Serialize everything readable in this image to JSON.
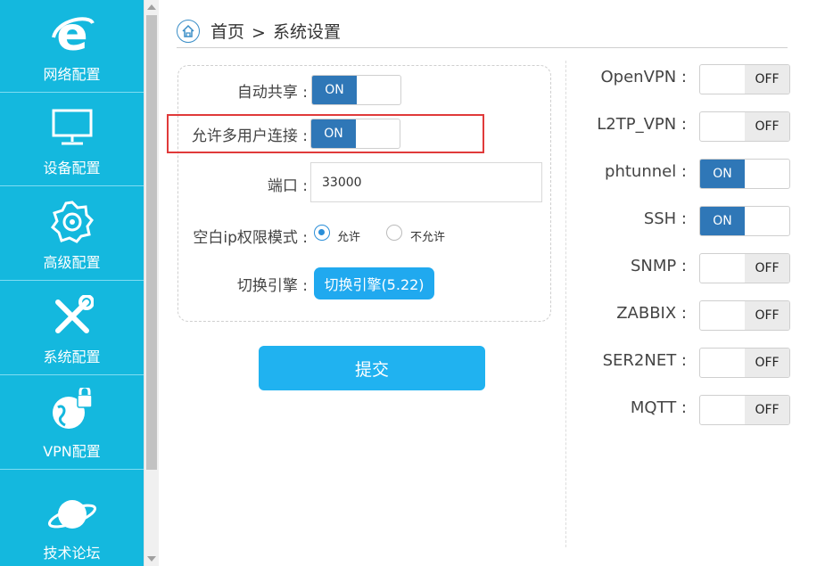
{
  "sidebar": {
    "items": [
      {
        "label": "网络配置",
        "icon": "internet-explorer-icon"
      },
      {
        "label": "设备配置",
        "icon": "monitor-icon"
      },
      {
        "label": "高级配置",
        "icon": "settings-gear-icon"
      },
      {
        "label": "系统配置",
        "icon": "tools-wrench-screwdriver-icon"
      },
      {
        "label": "VPN配置",
        "icon": "globe-lock-icon"
      },
      {
        "label": "技术论坛",
        "icon": "planet-icon"
      }
    ]
  },
  "breadcrumb": {
    "home": "首页",
    "separator": ">",
    "current": "系统设置"
  },
  "settings": {
    "auto_share": {
      "label": "自动共享 :",
      "state": "ON"
    },
    "multi_user": {
      "label": "允许多用户连接 :",
      "state": "ON"
    },
    "port": {
      "label": "端口 :",
      "value": "33000"
    },
    "whitelist_mode": {
      "label": "空白ip权限模式 :",
      "options": [
        "允许",
        "不允许"
      ],
      "selected": "允许"
    },
    "engine": {
      "label": "切换引擎 :",
      "button": "切换引擎(5.22)"
    }
  },
  "submit_label": "提交",
  "toggle_text": {
    "on": "ON",
    "off": "OFF"
  },
  "services": [
    {
      "label": "OpenVPN :",
      "state": "OFF"
    },
    {
      "label": "L2TP_VPN :",
      "state": "OFF"
    },
    {
      "label": "phtunnel :",
      "state": "ON"
    },
    {
      "label": "SSH :",
      "state": "ON"
    },
    {
      "label": "SNMP :",
      "state": "OFF"
    },
    {
      "label": "ZABBIX :",
      "state": "OFF"
    },
    {
      "label": "SER2NET :",
      "state": "OFF"
    },
    {
      "label": "MQTT :",
      "state": "OFF"
    }
  ],
  "colors": {
    "sidebar_bg": "#14b8de",
    "toggle_on": "#2f77b7",
    "button_blue": "#20b2f0",
    "highlight_red": "#e03a3a"
  }
}
